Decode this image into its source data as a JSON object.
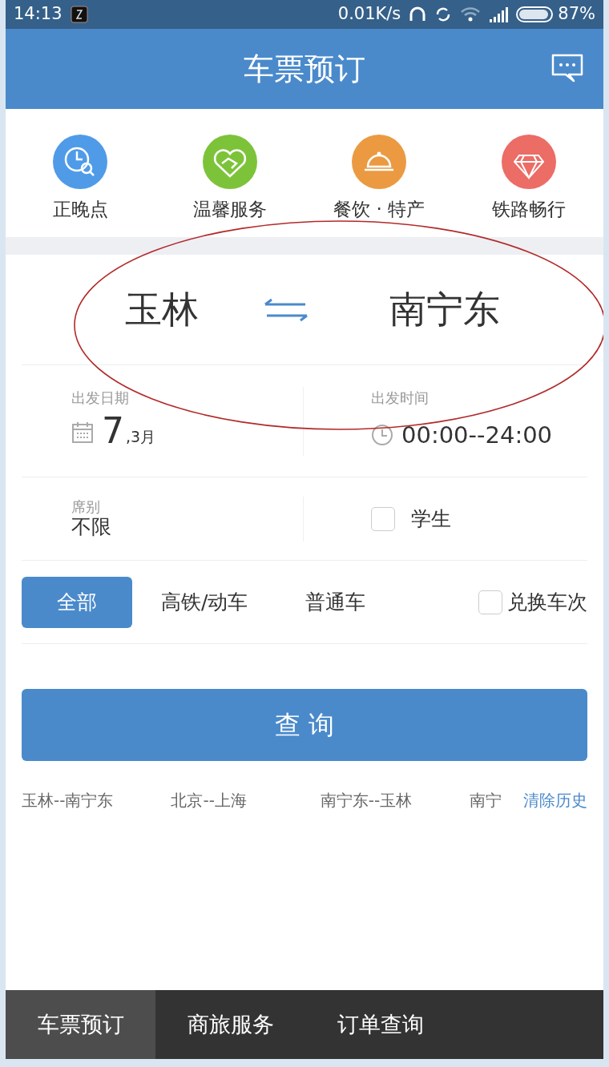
{
  "status_bar": {
    "time": "14:13",
    "speed": "0.01K/s",
    "battery": "87%"
  },
  "header": {
    "title": "车票预订"
  },
  "quick_links": [
    {
      "label": "正晚点",
      "kind": "clock",
      "color": "#4f9be8"
    },
    {
      "label": "温馨服务",
      "kind": "heart",
      "color": "#7dc33a"
    },
    {
      "label": "餐饮 · 特产",
      "kind": "dish",
      "color": "#eb9a42"
    },
    {
      "label": "铁路畅行",
      "kind": "diamond",
      "color": "#ec6c66"
    }
  ],
  "stations": {
    "from": "玉林",
    "to": "南宁东"
  },
  "departure_date": {
    "label": "出发日期",
    "day": "7",
    "month": ",3月"
  },
  "departure_time": {
    "label": "出发时间",
    "value": "00:00--24:00"
  },
  "seat": {
    "label": "席别",
    "value": "不限"
  },
  "student": {
    "label": "学生",
    "checked": false
  },
  "train_types": [
    {
      "label": "全部",
      "selected": true
    },
    {
      "label": "高铁/动车",
      "selected": false
    },
    {
      "label": "普通车",
      "selected": false
    }
  ],
  "exchange": {
    "label": "兑换车次",
    "checked": false
  },
  "query_button": "查 询",
  "history": [
    "玉林--南宁东",
    "北京--上海",
    "南宁东--玉林",
    "南宁"
  ],
  "clear_history": "清除历史",
  "bottom_tabs": [
    {
      "label": "车票预订",
      "selected": true
    },
    {
      "label": "商旅服务",
      "selected": false
    },
    {
      "label": "订单查询",
      "selected": false
    }
  ],
  "annotations": [
    {
      "kind": "ellipse"
    }
  ]
}
